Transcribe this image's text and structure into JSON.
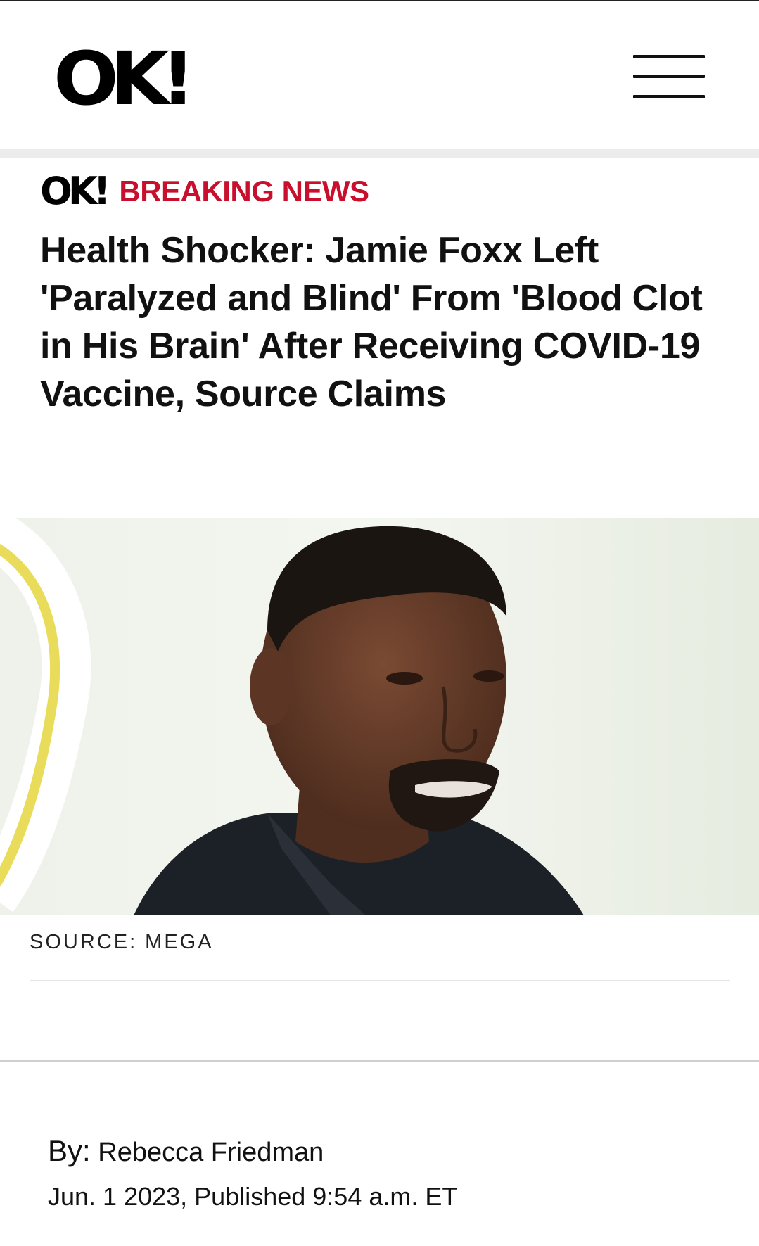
{
  "header": {
    "logo_text": "OK!",
    "menu_icon": "hamburger-menu-icon"
  },
  "article": {
    "kicker_logo": "OK!",
    "kicker": "BREAKING NEWS",
    "headline": "Health Shocker: Jamie Foxx Left 'Paralyzed and Blind' From 'Blood Clot in His Brain' After Receiving COVID-19 Vaccine, Source Claims",
    "image_caption": "SOURCE: MEGA",
    "byline_label": "By:",
    "author": "Rebecca Friedman",
    "date": "Jun. 1 2023, Published 9:54 a.m. ET"
  },
  "colors": {
    "accent": "#c8102e",
    "text": "#111111",
    "background": "#ffffff"
  }
}
